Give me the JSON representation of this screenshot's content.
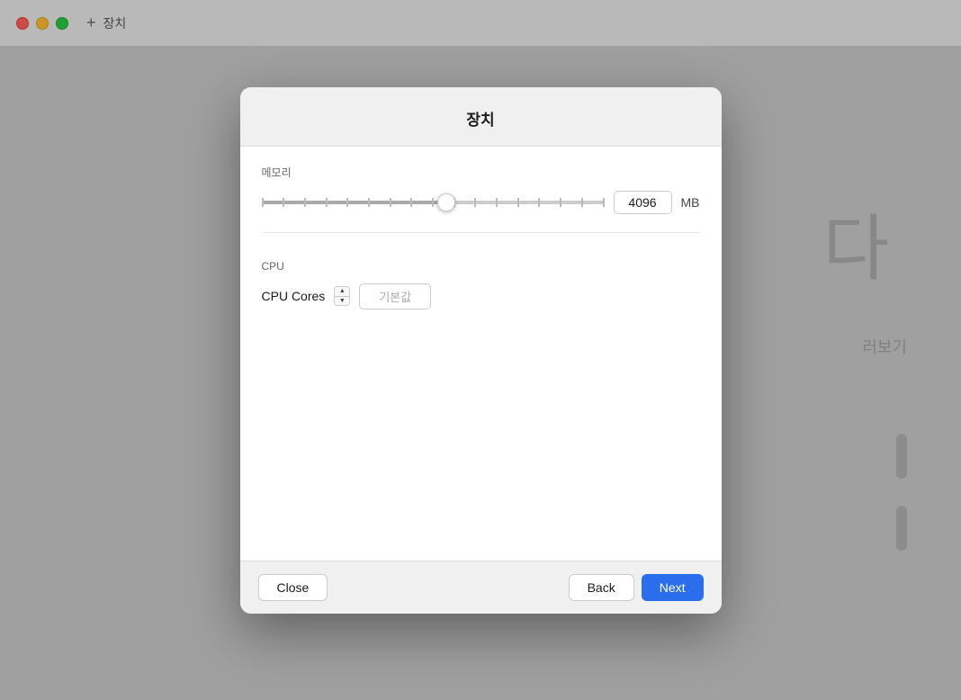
{
  "titleBar": {
    "addLabel": "+",
    "pageTitle": "장치"
  },
  "background": {
    "largeText": "다",
    "smallText": "러보기"
  },
  "modal": {
    "title": "장치",
    "memory": {
      "sectionLabel": "메모리",
      "value": "4096",
      "unit": "MB",
      "sliderValue": 55
    },
    "cpu": {
      "sectionLabel": "CPU",
      "coresLabel": "CPU Cores",
      "placeholder": "기본값"
    },
    "footer": {
      "closeLabel": "Close",
      "backLabel": "Back",
      "nextLabel": "Next"
    }
  }
}
